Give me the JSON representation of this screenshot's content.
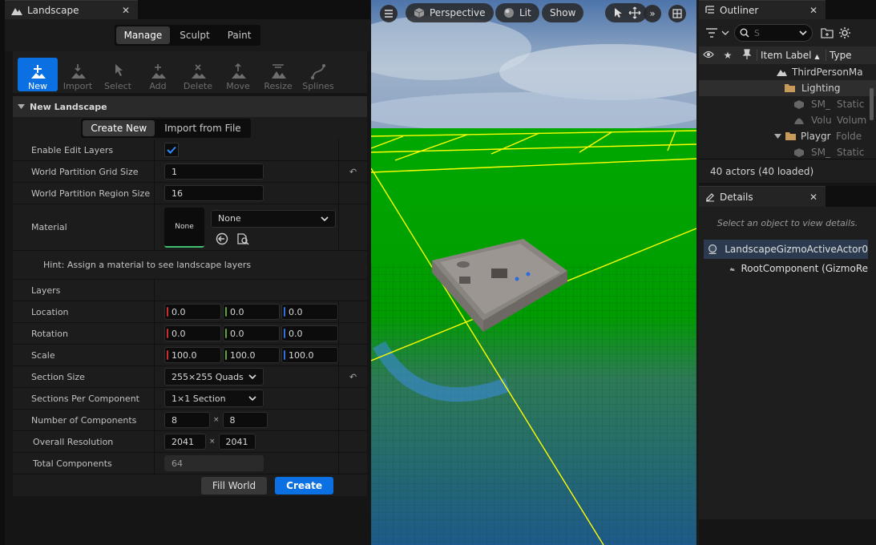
{
  "landscape_panel": {
    "tab_title": "Landscape",
    "modes": [
      "Manage",
      "Sculpt",
      "Paint"
    ],
    "active_mode": "Manage",
    "tools": [
      {
        "label": "New",
        "icon": "plus-icon"
      },
      {
        "label": "Import",
        "icon": "import-icon"
      },
      {
        "label": "Select",
        "icon": "select-cursor-icon"
      },
      {
        "label": "Add",
        "icon": "add-component-icon"
      },
      {
        "label": "Delete",
        "icon": "delete-component-icon"
      },
      {
        "label": "Move",
        "icon": "move-icon"
      },
      {
        "label": "Resize",
        "icon": "resize-icon"
      },
      {
        "label": "Splines",
        "icon": "splines-icon"
      }
    ],
    "section_title": "New Landscape",
    "create_tabs": [
      "Create New",
      "Import from File"
    ],
    "enable_edit_layers_label": "Enable Edit Layers",
    "enable_edit_layers": true,
    "grid_size_label": "World Partition Grid Size",
    "grid_size": "1",
    "region_size_label": "World Partition Region Size",
    "region_size": "16",
    "material_label": "Material",
    "material_thumb": "None",
    "material_value": "None",
    "hint": "Hint: Assign a material to see landscape layers",
    "layers_label": "Layers",
    "location_label": "Location",
    "location": [
      "0.0",
      "0.0",
      "0.0"
    ],
    "rotation_label": "Rotation",
    "rotation": [
      "0.0",
      "0.0",
      "0.0"
    ],
    "scale_label": "Scale",
    "scale": [
      "100.0",
      "100.0",
      "100.0"
    ],
    "section_size_label": "Section Size",
    "section_size": "255×255 Quads",
    "sections_per_component_label": "Sections Per Component",
    "sections_per_component": "1×1 Section",
    "num_components_label": "Number of Components",
    "num_components": [
      "8",
      "8"
    ],
    "overall_resolution_label": "Overall Resolution",
    "overall_resolution": [
      "2041",
      "2041"
    ],
    "times_symbol": "×",
    "total_components_label": "Total Components",
    "total_components": "64",
    "fill_world_label": "Fill World",
    "create_label": "Create"
  },
  "viewport": {
    "perspective_label": "Perspective",
    "lit_label": "Lit",
    "show_label": "Show",
    "sky_color": "#5a7fb0",
    "ground_color": "#00a000",
    "grid_line_color": "#ffff00"
  },
  "outliner": {
    "tab_title": "Outliner",
    "search_value": "S",
    "columns": {
      "item_label": "Item Label",
      "type": "Type"
    },
    "rows": [
      {
        "label": "ThirdPersonMa",
        "type": ""
      },
      {
        "label": "Lighting",
        "type": ""
      },
      {
        "label": "SM_",
        "type": "Static"
      },
      {
        "label": "Volu",
        "type": "Volum"
      },
      {
        "label": "Playgr",
        "type": "Folde"
      },
      {
        "label": "SM_",
        "type": "Static"
      }
    ],
    "footer": "40 actors (40 loaded)"
  },
  "details": {
    "tab_title": "Details",
    "hint": "Select an object to view details.",
    "actor": "LandscapeGizmoActiveActor0",
    "component": "RootComponent (GizmoRe"
  }
}
